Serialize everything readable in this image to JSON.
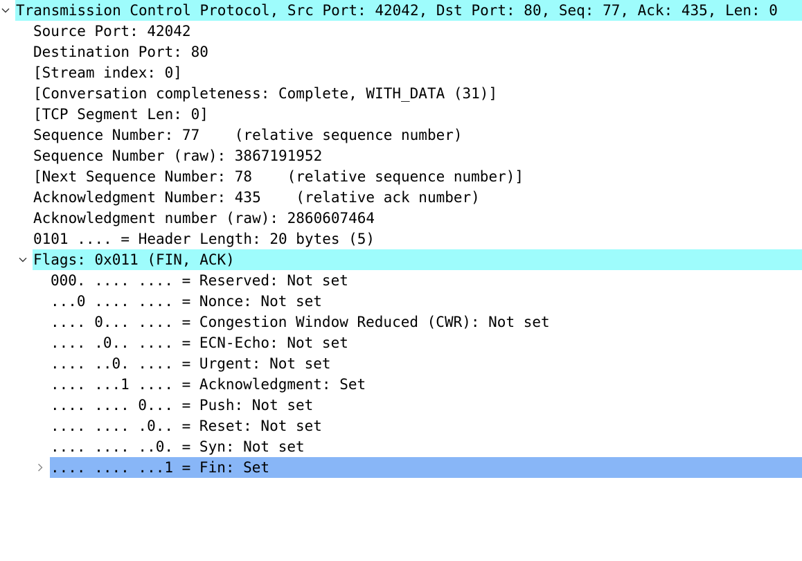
{
  "tcp": {
    "header": "Transmission Control Protocol, Src Port: 42042, Dst Port: 80, Seq: 77, Ack: 435, Len: 0",
    "fields": [
      "Source Port: 42042",
      "Destination Port: 80",
      "[Stream index: 0]",
      "[Conversation completeness: Complete, WITH_DATA (31)]",
      "[TCP Segment Len: 0]",
      "Sequence Number: 77    (relative sequence number)",
      "Sequence Number (raw): 3867191952",
      "[Next Sequence Number: 78    (relative sequence number)]",
      "Acknowledgment Number: 435    (relative ack number)",
      "Acknowledgment number (raw): 2860607464",
      "0101 .... = Header Length: 20 bytes (5)"
    ],
    "flags": {
      "header": "Flags: 0x011 (FIN, ACK)",
      "items": [
        "000. .... .... = Reserved: Not set",
        "...0 .... .... = Nonce: Not set",
        ".... 0... .... = Congestion Window Reduced (CWR): Not set",
        ".... .0.. .... = ECN-Echo: Not set",
        ".... ..0. .... = Urgent: Not set",
        ".... ...1 .... = Acknowledgment: Set",
        ".... .... 0... = Push: Not set",
        ".... .... .0.. = Reset: Not set",
        ".... .... ..0. = Syn: Not set",
        ".... .... ...1 = Fin: Set"
      ]
    }
  },
  "icons": {
    "expanded": "chevron-down-icon",
    "collapsed": "chevron-right-icon"
  },
  "colors": {
    "highlight_cyan": "#9efcfc",
    "selected_blue": "#88b6f7"
  }
}
